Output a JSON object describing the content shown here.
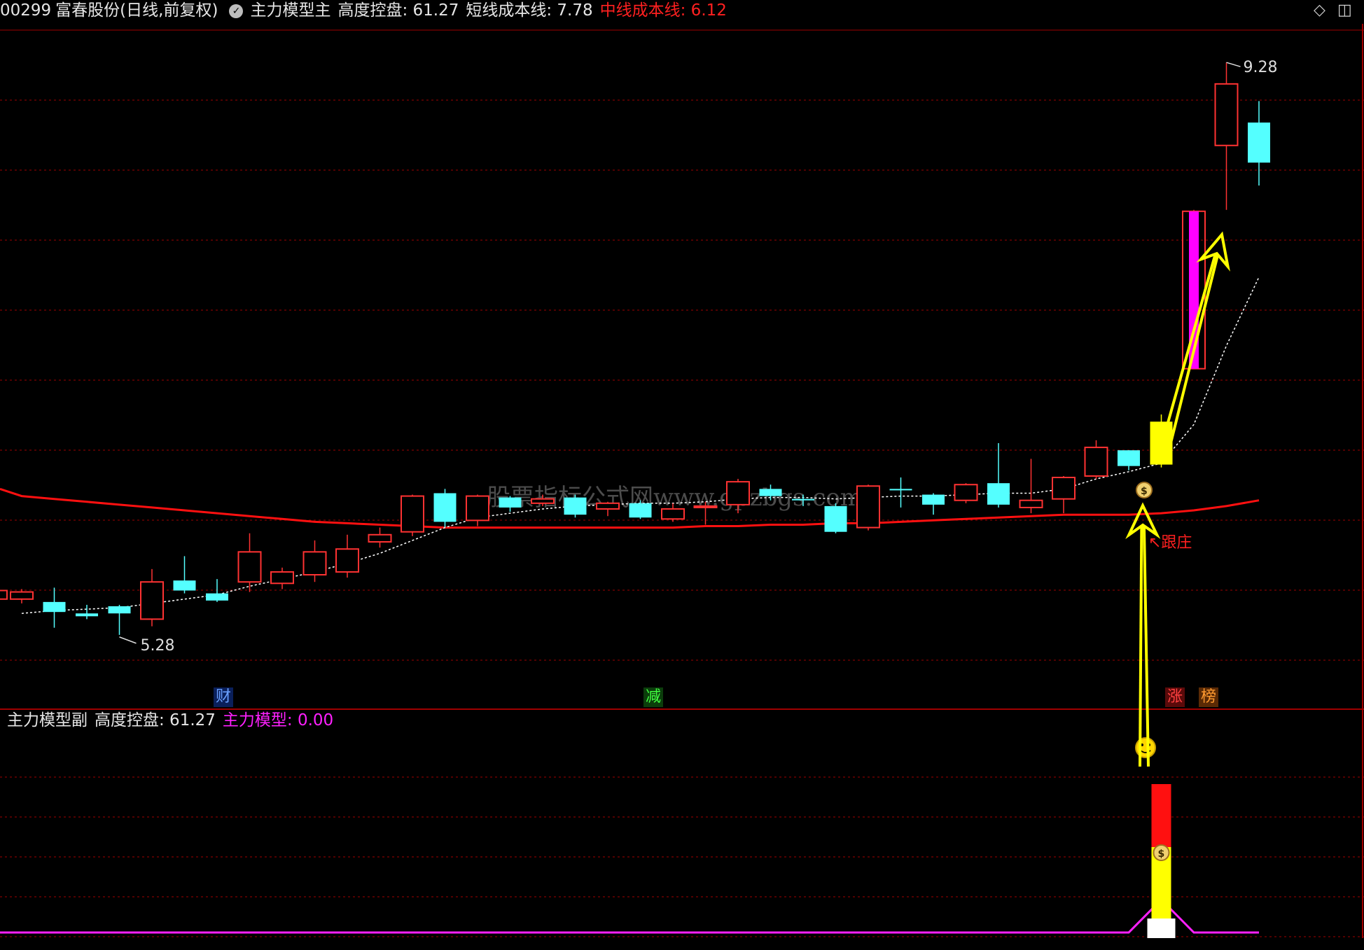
{
  "header": {
    "code": "00299",
    "name": "富春股份(日线,前复权)",
    "indicator_name": "主力模型主",
    "control_label": "高度控盘: 61.27",
    "short_cost_label": "短线成本线: 7.78",
    "mid_cost_label": "中线成本线: 6.12"
  },
  "sub_header": {
    "indicator_name": "主力模型副",
    "control_label": "高度控盘: 61.27",
    "model_label": "主力模型: 0.00"
  },
  "annotations": {
    "high_label": "9.28",
    "low_label": "5.28",
    "follow_label": "跟庄",
    "watermark": "股票指标公式网www.gpzbgs.com"
  },
  "markers": [
    {
      "text": "财",
      "color": "#6aa0ff"
    },
    {
      "text": "减",
      "color": "#40ff40"
    },
    {
      "text": "涨",
      "color": "#ff4040"
    },
    {
      "text": "榜",
      "color": "#ff9a30"
    }
  ],
  "colors": {
    "up": "#ff3232",
    "down": "#54ffff",
    "mid_cost": "#ff1010",
    "grid": "#a00000",
    "arrow": "#ffff00",
    "model_line": "#ff20ff"
  },
  "chart_data": {
    "type": "candlestick",
    "title": "",
    "price_range": [
      4.8,
      9.55
    ],
    "candles": [
      {
        "o": 5.53,
        "c": 5.58,
        "h": 5.6,
        "l": 5.5
      },
      {
        "o": 5.51,
        "c": 5.44,
        "h": 5.61,
        "l": 5.33
      },
      {
        "o": 5.43,
        "c": 5.41,
        "h": 5.49,
        "l": 5.39
      },
      {
        "o": 5.48,
        "c": 5.43,
        "h": 5.49,
        "l": 5.28
      },
      {
        "o": 5.39,
        "c": 5.65,
        "h": 5.74,
        "l": 5.34
      },
      {
        "o": 5.66,
        "c": 5.59,
        "h": 5.83,
        "l": 5.57
      },
      {
        "o": 5.57,
        "c": 5.52,
        "h": 5.67,
        "l": 5.51
      },
      {
        "o": 5.65,
        "c": 5.86,
        "h": 5.99,
        "l": 5.58
      },
      {
        "o": 5.64,
        "c": 5.72,
        "h": 5.75,
        "l": 5.6
      },
      {
        "o": 5.7,
        "c": 5.86,
        "h": 5.94,
        "l": 5.65
      },
      {
        "o": 5.72,
        "c": 5.88,
        "h": 5.98,
        "l": 5.68
      },
      {
        "o": 5.93,
        "c": 5.98,
        "h": 6.03,
        "l": 5.89
      },
      {
        "o": 6.0,
        "c": 6.25,
        "h": 6.26,
        "l": 5.97
      },
      {
        "o": 6.27,
        "c": 6.07,
        "h": 6.3,
        "l": 6.03
      },
      {
        "o": 6.08,
        "c": 6.25,
        "h": 6.26,
        "l": 6.04
      },
      {
        "o": 6.24,
        "c": 6.17,
        "h": 6.25,
        "l": 6.14
      },
      {
        "o": 6.2,
        "c": 6.23,
        "h": 6.26,
        "l": 6.18
      },
      {
        "o": 6.24,
        "c": 6.12,
        "h": 6.26,
        "l": 6.1
      },
      {
        "o": 6.16,
        "c": 6.2,
        "h": 6.21,
        "l": 6.11
      },
      {
        "o": 6.2,
        "c": 6.1,
        "h": 6.22,
        "l": 6.09
      },
      {
        "o": 6.09,
        "c": 6.16,
        "h": 6.2,
        "l": 6.07
      },
      {
        "o": 6.17,
        "c": 6.18,
        "h": 6.21,
        "l": 6.05
      },
      {
        "o": 6.19,
        "c": 6.35,
        "h": 6.37,
        "l": 6.13
      },
      {
        "o": 6.3,
        "c": 6.25,
        "h": 6.33,
        "l": 6.22
      },
      {
        "o": 6.23,
        "c": 6.22,
        "h": 6.26,
        "l": 6.18
      },
      {
        "o": 6.18,
        "c": 6.0,
        "h": 6.2,
        "l": 5.99
      },
      {
        "o": 6.03,
        "c": 6.32,
        "h": 6.33,
        "l": 6.01
      },
      {
        "o": 6.3,
        "c": 6.29,
        "h": 6.38,
        "l": 6.17
      },
      {
        "o": 6.26,
        "c": 6.19,
        "h": 6.27,
        "l": 6.12
      },
      {
        "o": 6.22,
        "c": 6.33,
        "h": 6.34,
        "l": 6.2
      },
      {
        "o": 6.34,
        "c": 6.19,
        "h": 6.62,
        "l": 6.17
      },
      {
        "o": 6.17,
        "c": 6.22,
        "h": 6.51,
        "l": 6.13
      },
      {
        "o": 6.23,
        "c": 6.38,
        "h": 6.39,
        "l": 6.13
      },
      {
        "o": 6.39,
        "c": 6.59,
        "h": 6.64,
        "l": 6.37
      },
      {
        "o": 6.57,
        "c": 6.46,
        "h": 6.57,
        "l": 6.43
      },
      {
        "o": 6.47,
        "c": 6.77,
        "h": 6.82,
        "l": 6.45
      },
      {
        "o": 7.14,
        "c": 8.24,
        "h": 8.25,
        "l": 7.14
      },
      {
        "o": 8.7,
        "c": 9.13,
        "h": 9.28,
        "l": 8.25
      },
      {
        "o": 8.86,
        "c": 8.58,
        "h": 9.01,
        "l": 8.42
      }
    ],
    "short_cost_line": [
      5.43,
      5.45,
      5.46,
      5.47,
      5.5,
      5.53,
      5.56,
      5.62,
      5.67,
      5.72,
      5.78,
      5.85,
      5.94,
      6.03,
      6.1,
      6.13,
      6.16,
      6.18,
      6.19,
      6.2,
      6.2,
      6.21,
      6.23,
      6.24,
      6.24,
      6.23,
      6.24,
      6.25,
      6.25,
      6.26,
      6.27,
      6.27,
      6.3,
      6.37,
      6.42,
      6.48,
      6.75,
      7.3,
      7.78
    ],
    "mid_cost_line": [
      6.25,
      6.23,
      6.21,
      6.19,
      6.17,
      6.15,
      6.13,
      6.11,
      6.09,
      6.07,
      6.06,
      6.05,
      6.04,
      6.03,
      6.03,
      6.03,
      6.03,
      6.03,
      6.03,
      6.03,
      6.03,
      6.04,
      6.04,
      6.05,
      6.05,
      6.06,
      6.06,
      6.07,
      6.08,
      6.09,
      6.1,
      6.11,
      6.12,
      6.12,
      6.12,
      6.13,
      6.15,
      6.18,
      6.22
    ],
    "sub_range": [
      0,
      100
    ],
    "model_values": [
      0,
      0,
      0,
      0,
      0,
      0,
      0,
      0,
      0,
      0,
      0,
      0,
      0,
      0,
      0,
      0,
      0,
      0,
      0,
      0,
      0,
      0,
      0,
      0,
      0,
      0,
      0,
      0,
      0,
      0,
      0,
      0,
      0,
      0,
      0,
      100,
      0,
      0,
      0
    ]
  }
}
